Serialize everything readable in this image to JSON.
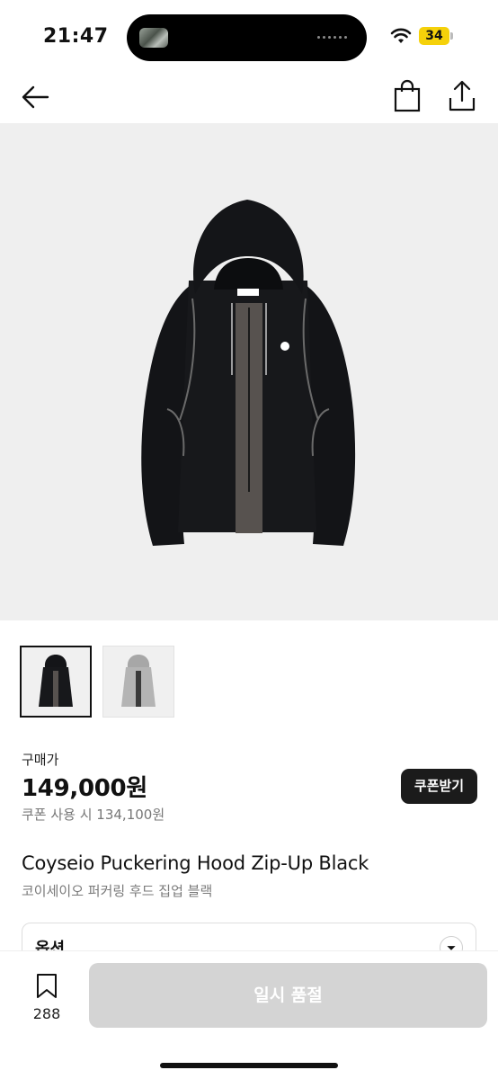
{
  "status_bar": {
    "time": "21:47",
    "battery": "34"
  },
  "nav": {
    "back_icon": "back-arrow-icon",
    "bag_icon": "shopping-bag-icon",
    "share_icon": "share-icon"
  },
  "product": {
    "brand_tag": "COYSEIO",
    "price_label": "구매가",
    "price": "149,000원",
    "coupon_price": "쿠폰 사용 시 134,100원",
    "coupon_button": "쿠폰받기",
    "name_en": "Coyseio Puckering Hood Zip-Up Black",
    "name_ko": "코이세이오 퍼커링 후드 집업 블랙"
  },
  "thumbnails": [
    {
      "color": "black",
      "selected": true
    },
    {
      "color": "gray",
      "selected": false
    }
  ],
  "option": {
    "label": "옵션"
  },
  "bottom": {
    "wish_count": "288",
    "sold_out_button": "일시 품절"
  },
  "colors": {
    "accent_dark": "#1b1b1b",
    "disabled": "#d4d4d4",
    "hero_bg": "#efefef"
  }
}
